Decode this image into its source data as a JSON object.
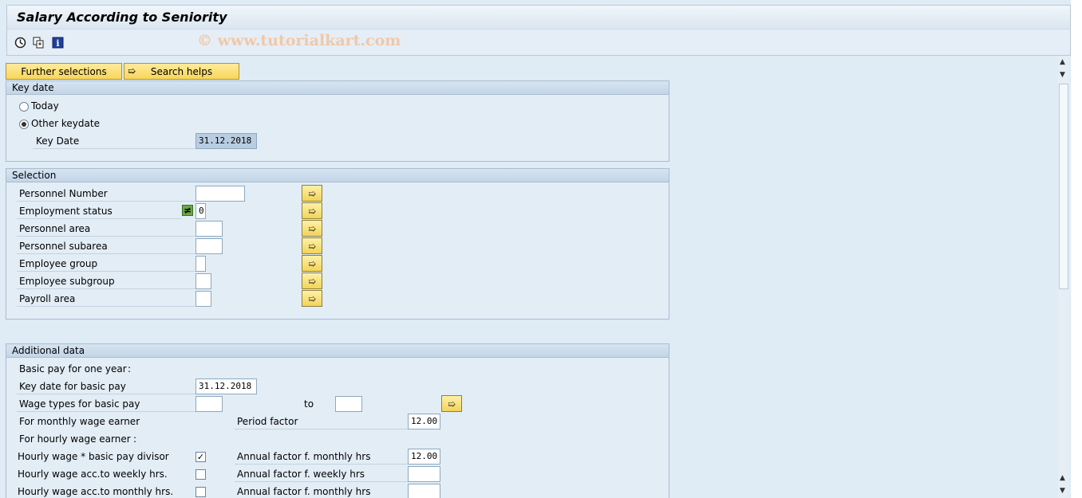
{
  "window": {
    "title": "Salary According to Seniority"
  },
  "toolbar": {
    "icons": [
      "execute-icon",
      "copy-variant-icon",
      "info-icon"
    ],
    "watermark": "© www.tutorialkart.com"
  },
  "buttons": {
    "further_selections": "Further selections",
    "search_helps": "Search helps"
  },
  "key_date": {
    "header": "Key date",
    "today_label": "Today",
    "other_label": "Other keydate",
    "selected": "other",
    "field_label": "Key Date",
    "field_value": "31.12.2018"
  },
  "selection": {
    "header": "Selection",
    "fields": [
      {
        "label": "Personnel Number",
        "value": ""
      },
      {
        "label": "Employment status",
        "value": "0",
        "operator": "≠"
      },
      {
        "label": "Personnel area",
        "value": ""
      },
      {
        "label": "Personnel subarea",
        "value": ""
      },
      {
        "label": "Employee group",
        "value": ""
      },
      {
        "label": "Employee subgroup",
        "value": ""
      },
      {
        "label": "Payroll area",
        "value": ""
      }
    ]
  },
  "additional": {
    "header": "Additional data",
    "basic_pay_label": "Basic pay for one year",
    "colon": ":",
    "key_date_basic_label": "Key date for basic pay",
    "key_date_basic_value": "31.12.2018",
    "wage_types_label": "Wage types for basic pay",
    "to_label": "to",
    "monthly_earner_label": "For monthly wage earner",
    "period_factor_label": "Period factor",
    "period_factor_value": "12.00",
    "hourly_earner_label": "For hourly wage earner",
    "hourly_divisor_label": "Hourly wage * basic pay divisor",
    "hourly_divisor_checked": true,
    "annual_monthly_label": "Annual factor f. monthly hrs",
    "annual_monthly_value": "12.00",
    "hourly_weekly_label": "Hourly wage acc.to weekly hrs.",
    "annual_weekly_label": "Annual factor f. weekly hrs",
    "hourly_monthly_label": "Hourly wage acc.to monthly hrs.",
    "annual_monthly2_label": "Annual factor f. monthly hrs"
  }
}
